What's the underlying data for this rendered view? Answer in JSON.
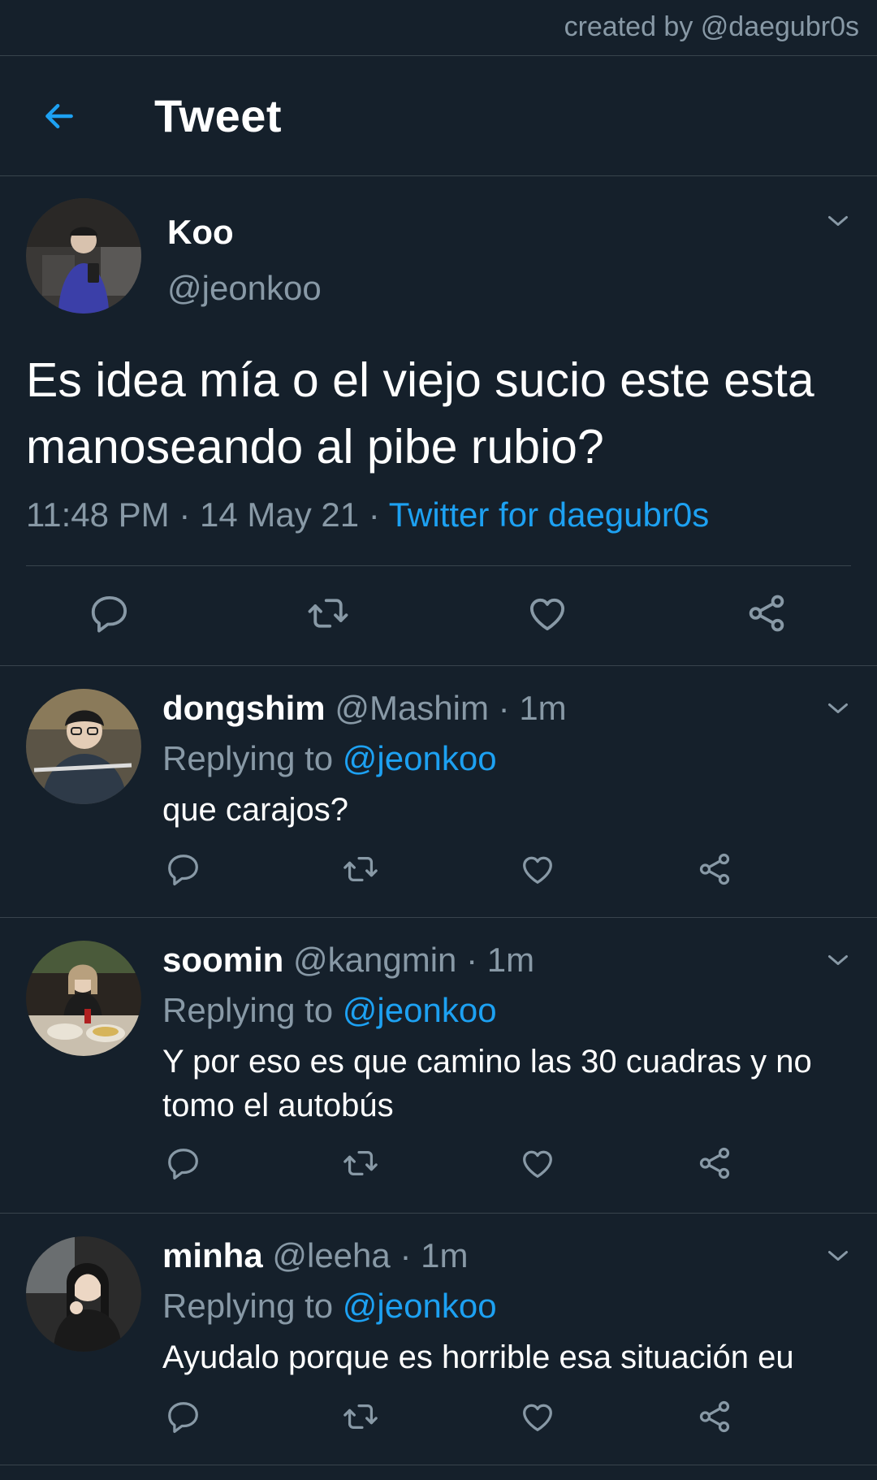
{
  "credit": "created by @daegubr0s",
  "header": {
    "title": "Tweet"
  },
  "tweet": {
    "name": "Koo",
    "handle": "@jeonkoo",
    "text": "Es idea mía o el viejo sucio este esta manoseando al pibe rubio?",
    "time": "11:48 PM",
    "date": "14 May 21",
    "source": "Twitter for daegubr0s"
  },
  "replies": [
    {
      "name": "dongshim",
      "handle": "@Mashim",
      "time": "1m",
      "replying_label": "Replying to",
      "replying_to": "@jeonkoo",
      "text": "que carajos?"
    },
    {
      "name": "soomin",
      "handle": "@kangmin",
      "time": "1m",
      "replying_label": "Replying to",
      "replying_to": "@jeonkoo",
      "text": "Y por eso es que camino las 30 cuadras y no tomo el autobús"
    },
    {
      "name": "minha",
      "handle": "@leeha",
      "time": "1m",
      "replying_label": "Replying to",
      "replying_to": "@jeonkoo",
      "text": "Ayudalo porque es horrible esa situación eu"
    }
  ],
  "colors": {
    "background": "#15202b",
    "accent": "#1da1f2",
    "secondary_text": "#8899a6",
    "divider": "#38444d"
  },
  "icons": [
    "back-arrow-icon",
    "chevron-down-icon",
    "reply-icon",
    "retweet-icon",
    "like-icon",
    "share-icon"
  ]
}
